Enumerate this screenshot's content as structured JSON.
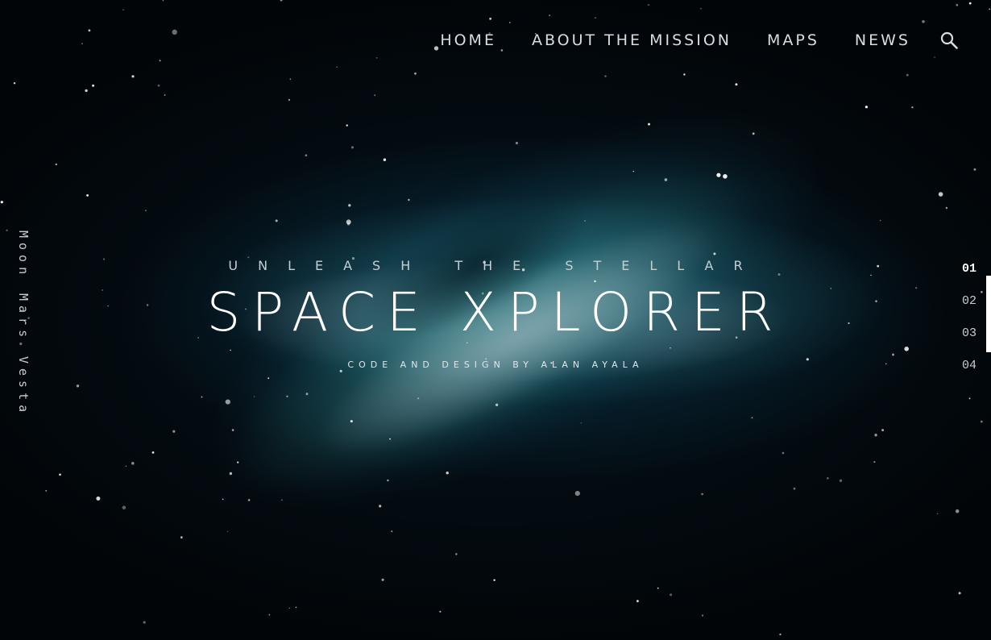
{
  "nav": {
    "items": [
      {
        "label": "HOME"
      },
      {
        "label": "ABOUT THE MISSION"
      },
      {
        "label": "MAPS"
      },
      {
        "label": "NEWS"
      }
    ],
    "search_icon": "search-icon"
  },
  "side_links": [
    "Moon",
    "Mars",
    "Vesta"
  ],
  "hero": {
    "subtitle": "UNLEASH THE STELLAR",
    "title": "SPACE XPLORER",
    "credit": "CODE AND DESIGN BY ALAN AYALA"
  },
  "pager": {
    "items": [
      "01",
      "02",
      "03",
      "04"
    ],
    "active": "01"
  },
  "colors": {
    "background": "#020508",
    "nebula": "#2a7a82",
    "text": "#ffffff"
  }
}
